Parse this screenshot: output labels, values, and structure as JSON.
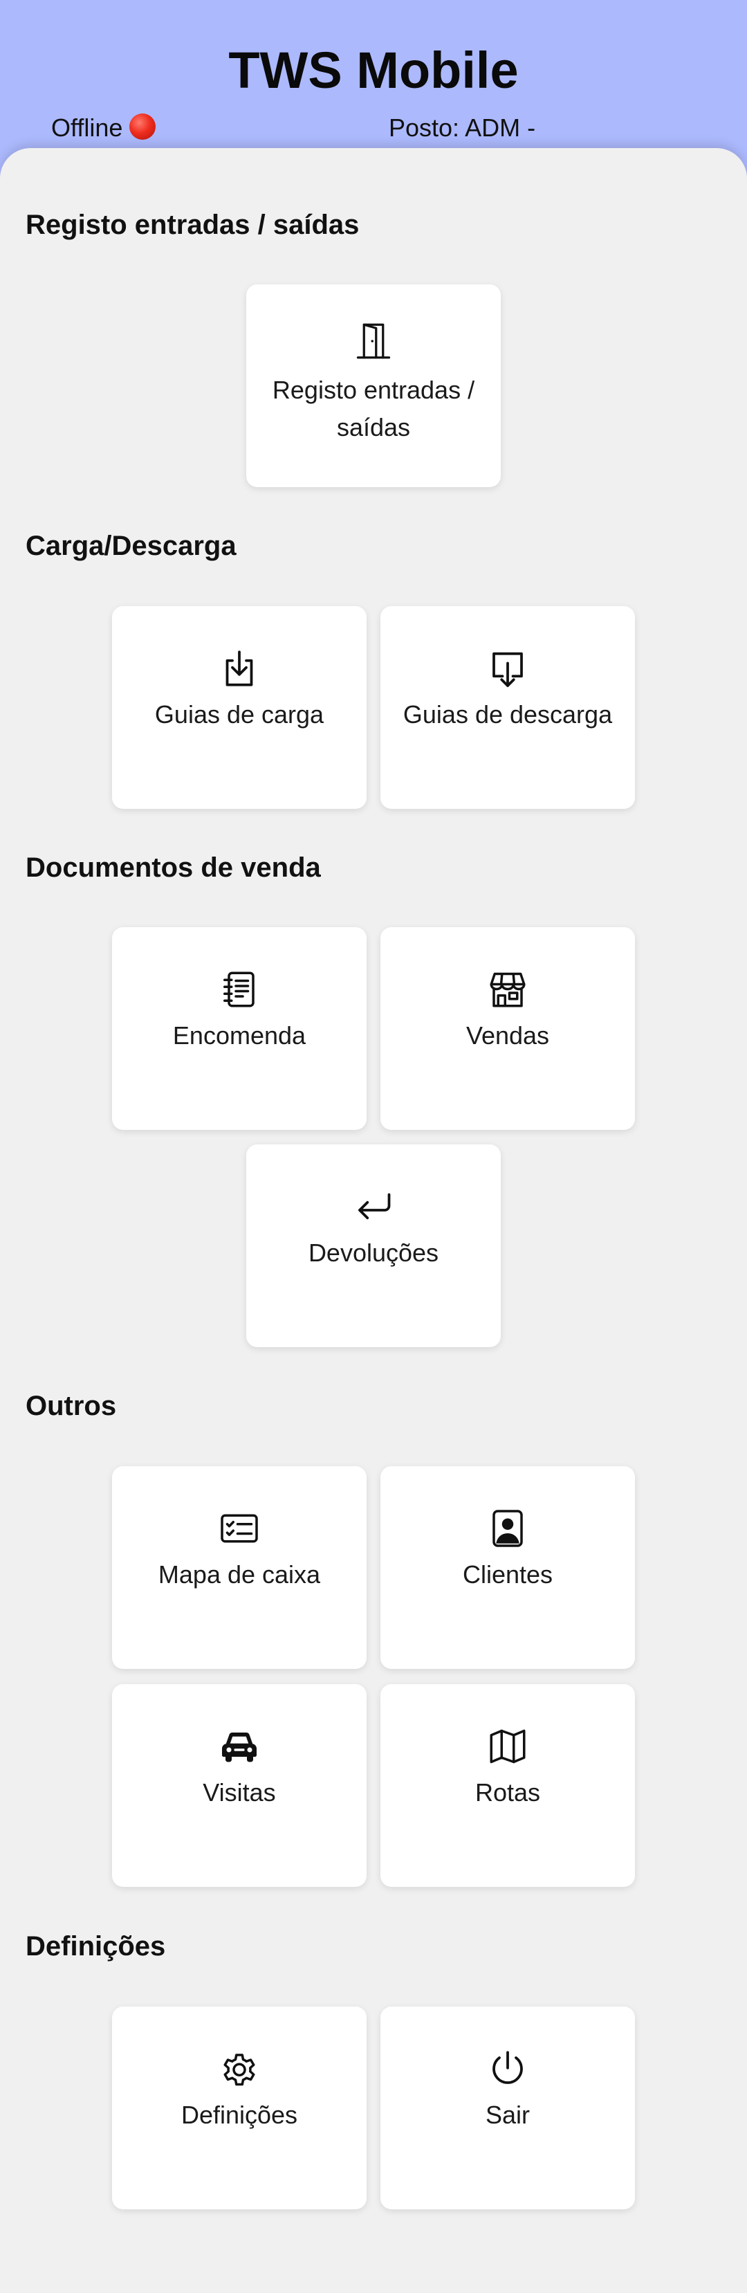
{
  "header": {
    "title": "TWS Mobile",
    "status": "Offline",
    "posto": "Posto: ADM -",
    "background_color": "#acb9fd",
    "status_dot_color": "#ee2d1f",
    "status_dot_icon": "red-circle-icon"
  },
  "sections": {
    "registo": {
      "title": "Registo entradas / saídas",
      "tiles": [
        {
          "label": "Registo entradas / saídas",
          "icon": "door-icon"
        }
      ]
    },
    "carga": {
      "title": "Carga/Descarga",
      "tiles": [
        {
          "label": "Guias de carga",
          "icon": "download-tray-icon"
        },
        {
          "label": "Guias de descarga",
          "icon": "download-box-icon"
        }
      ]
    },
    "documentos": {
      "title": "Documentos de venda",
      "tiles": [
        {
          "label": "Encomenda",
          "icon": "notebook-icon"
        },
        {
          "label": "Vendas",
          "icon": "shop-icon"
        },
        {
          "label": "Devoluções",
          "icon": "return-arrow-icon"
        }
      ]
    },
    "outros": {
      "title": "Outros",
      "tiles": [
        {
          "label": "Mapa de caixa",
          "icon": "checklist-card-icon"
        },
        {
          "label": "Clientes",
          "icon": "contact-person-icon"
        },
        {
          "label": "Visitas",
          "icon": "car-icon"
        },
        {
          "label": "Rotas",
          "icon": "map-icon"
        }
      ]
    },
    "definicoes": {
      "title": "Definições",
      "tiles": [
        {
          "label": "Definições",
          "icon": "gear-icon"
        },
        {
          "label": "Sair",
          "icon": "power-icon"
        }
      ]
    }
  }
}
